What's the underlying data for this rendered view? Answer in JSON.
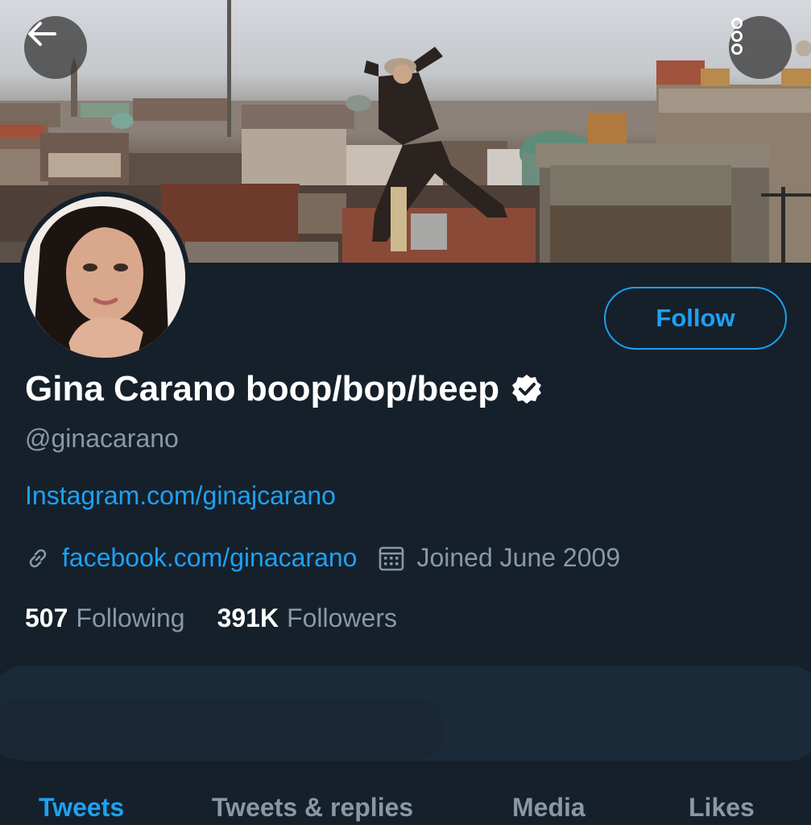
{
  "header": {
    "back_icon": "arrow-left-icon",
    "more_icon": "more-vertical-icon"
  },
  "profile": {
    "display_name": "Gina Carano boop/bop/beep",
    "verified_icon": "verified-badge-icon",
    "handle": "@ginacarano",
    "bio_link": "Instagram.com/ginajcarano",
    "website_icon": "link-icon",
    "website": "facebook.com/ginacarano",
    "calendar_icon": "calendar-icon",
    "joined": "Joined June 2009",
    "follow_label": "Follow"
  },
  "stats": {
    "following_count": "507",
    "following_label": "Following",
    "followers_count": "391K",
    "followers_label": "Followers"
  },
  "tabs": [
    {
      "label": "Tweets",
      "active": true
    },
    {
      "label": "Tweets & replies",
      "active": false
    },
    {
      "label": "Media",
      "active": false
    },
    {
      "label": "Likes",
      "active": false
    }
  ],
  "colors": {
    "background": "#15202b",
    "accent": "#1da1f2",
    "secondary_text": "#8899a6",
    "primary_text": "#ffffff"
  }
}
